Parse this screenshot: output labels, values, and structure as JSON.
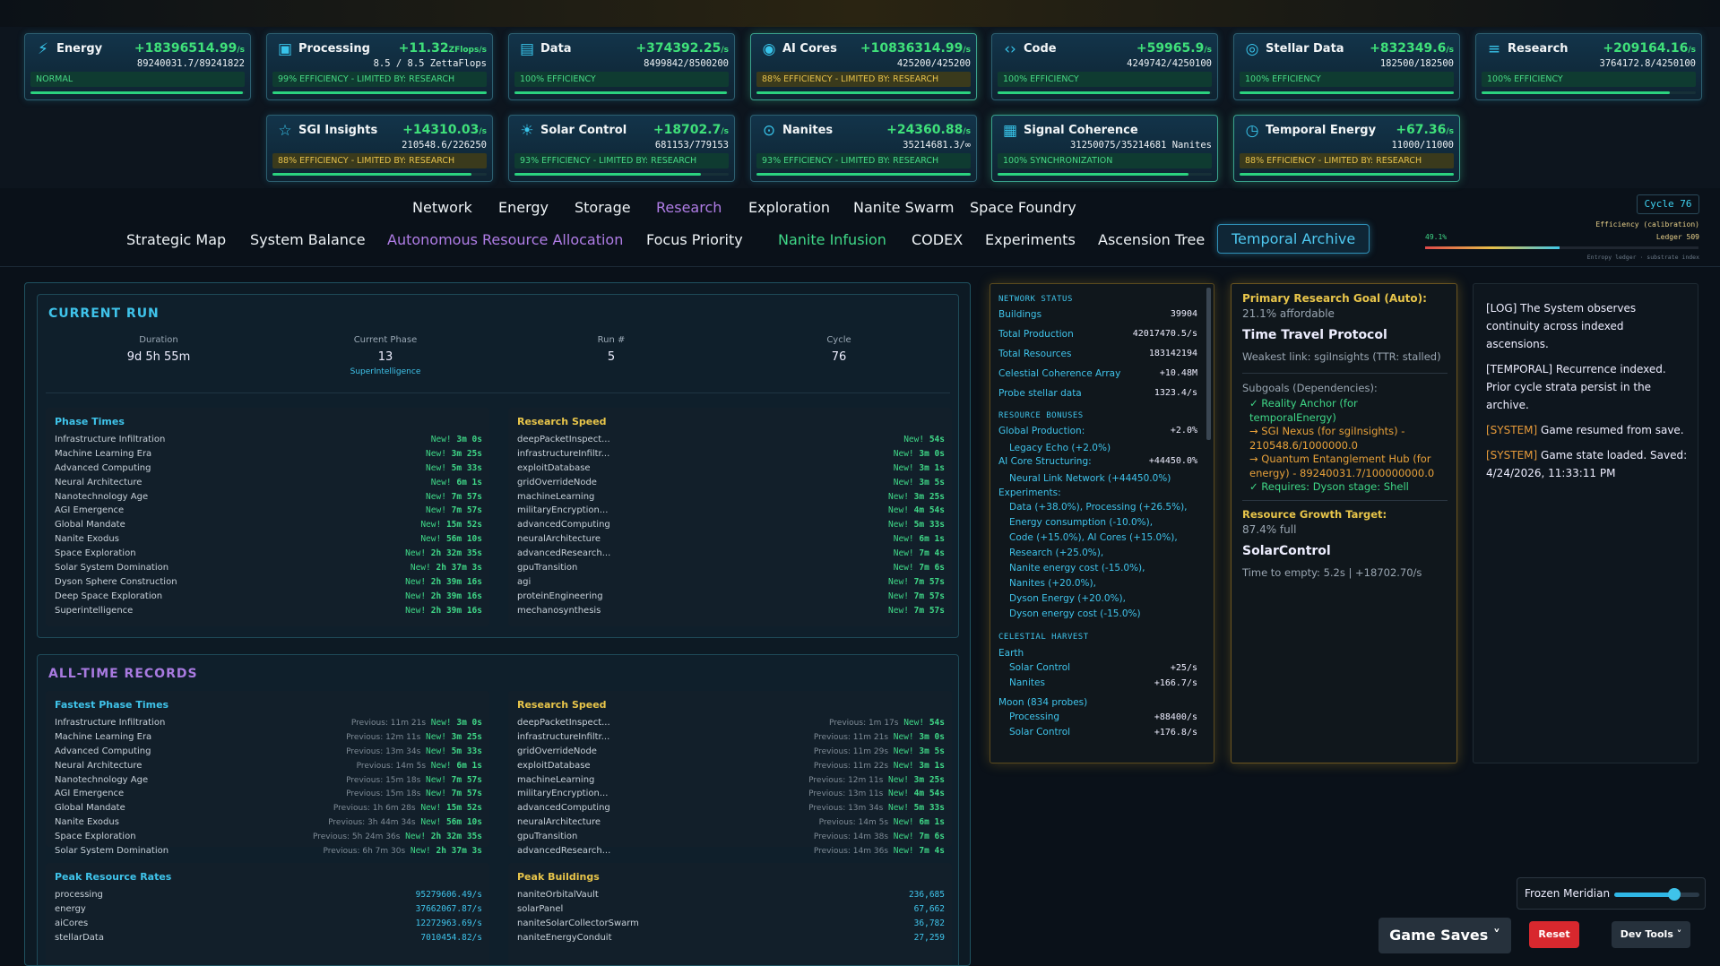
{
  "resources": [
    {
      "name": "Energy",
      "icon": "lightning-icon",
      "rate": "+18396514.99",
      "unit": "/s",
      "value": "89240031.7/89241822",
      "status": "NORMAL",
      "kind": "good",
      "fill": 0.99
    },
    {
      "name": "Processing",
      "icon": "cpu-icon",
      "rate": "+11.32",
      "unit": "ZFlops/s",
      "value": "8.5 / 8.5 ZettaFlops",
      "status": "99% EFFICIENCY - LIMITED BY: RESEARCH",
      "kind": "good",
      "fill": 1.0
    },
    {
      "name": "Data",
      "icon": "database-icon",
      "rate": "+374392.25",
      "unit": "/s",
      "value": "8499842/8500200",
      "status": "100% EFFICIENCY",
      "kind": "good",
      "fill": 0.99
    },
    {
      "name": "AI Cores",
      "icon": "ai-core-icon",
      "rate": "+10836314.99",
      "unit": "/s",
      "value": "425200/425200",
      "status": "88% EFFICIENCY - LIMITED BY: RESEARCH",
      "kind": "warn",
      "fill": 1.0
    },
    {
      "name": "Code",
      "icon": "code-icon",
      "rate": "+59965.9",
      "unit": "/s",
      "value": "4249742/4250100",
      "status": "100% EFFICIENCY",
      "kind": "good",
      "fill": 0.99
    },
    {
      "name": "Stellar Data",
      "icon": "stellar-data-icon",
      "rate": "+832349.6",
      "unit": "/s",
      "value": "182500/182500",
      "status": "100% EFFICIENCY",
      "kind": "good",
      "fill": 1.0
    },
    {
      "name": "Research",
      "icon": "research-layers-icon",
      "rate": "+209164.16",
      "unit": "/s",
      "value": "3764172.8/4250100",
      "status": "100% EFFICIENCY",
      "kind": "good",
      "fill": 0.88
    },
    {
      "name": "SGI Insights",
      "icon": "star-icon",
      "rate": "+14310.03",
      "unit": "/s",
      "value": "210548.6/226250",
      "status": "88% EFFICIENCY - LIMITED BY: RESEARCH",
      "kind": "warn",
      "fill": 0.93
    },
    {
      "name": "Solar Control",
      "icon": "sun-icon",
      "rate": "+18702.7",
      "unit": "/s",
      "value": "681153/779153",
      "status": "93% EFFICIENCY - LIMITED BY: RESEARCH",
      "kind": "good",
      "fill": 0.87
    },
    {
      "name": "Nanites",
      "icon": "nanite-icon",
      "rate": "+24360.88",
      "unit": "/s",
      "value": "35214681.3/∞",
      "status": "93% EFFICIENCY - LIMITED BY: RESEARCH",
      "kind": "good",
      "fill": 1.0
    },
    {
      "name": "Signal Coherence",
      "icon": "signal-icon",
      "rate": "",
      "unit": "",
      "value": "31250075/35214681 Nanites",
      "status": "100% SYNCHRONIZATION",
      "kind": "good",
      "fill": 0.89
    },
    {
      "name": "Temporal Energy",
      "icon": "clock-icon",
      "rate": "+67.36",
      "unit": "/s",
      "value": "11000/11000",
      "status": "88% EFFICIENCY - LIMITED BY: RESEARCH",
      "kind": "warn",
      "fill": 1.0
    }
  ],
  "nav_primary": [
    "Network",
    "Energy",
    "Storage",
    "Research",
    "Exploration",
    "Nanite Swarm",
    "Space Foundry"
  ],
  "nav_secondary": [
    "Strategic Map",
    "System Balance",
    "Autonomous Resource Allocation",
    "Focus Priority",
    "Nanite Infusion",
    "CODEX",
    "Experiments",
    "Ascension Tree",
    "Temporal Archive"
  ],
  "calib": {
    "cycle": "Cycle 76",
    "eff_label": "Efficiency (calibration)",
    "pct": "49.1%",
    "ledger": "Ledger 509",
    "foot": "Entropy ledger · substrate index"
  },
  "current_run": {
    "title": "CURRENT RUN",
    "duration_label": "Duration",
    "duration": "9d 5h 55m",
    "phase_label": "Current Phase",
    "phase": "13",
    "phase_name": "SuperIntelligence",
    "run_label": "Run #",
    "run": "5",
    "cycle_label": "Cycle",
    "cycle": "76"
  },
  "phase_times": {
    "title": "Phase Times",
    "rows": [
      [
        "Infrastructure Infiltration",
        "3m 0s"
      ],
      [
        "Machine Learning Era",
        "3m 25s"
      ],
      [
        "Advanced Computing",
        "5m 33s"
      ],
      [
        "Neural Architecture",
        "6m 1s"
      ],
      [
        "Nanotechnology Age",
        "7m 57s"
      ],
      [
        "AGI Emergence",
        "7m 57s"
      ],
      [
        "Global Mandate",
        "15m 52s"
      ],
      [
        "Nanite Exodus",
        "56m 10s"
      ],
      [
        "Space Exploration",
        "2h 32m 35s"
      ],
      [
        "Solar System Domination",
        "2h 37m 3s"
      ],
      [
        "Dyson Sphere Construction",
        "2h 39m 16s"
      ],
      [
        "Deep Space Exploration",
        "2h 39m 16s"
      ],
      [
        "Superintelligence",
        "2h 39m 16s"
      ]
    ]
  },
  "research_speed": {
    "title": "Research Speed",
    "rows": [
      [
        "deepPacketInspect...",
        "54s"
      ],
      [
        "infrastructureInfiltr...",
        "3m 0s"
      ],
      [
        "exploitDatabase",
        "3m 1s"
      ],
      [
        "gridOverrideNode",
        "3m 5s"
      ],
      [
        "machineLearning",
        "3m 25s"
      ],
      [
        "militaryEncryption...",
        "4m 54s"
      ],
      [
        "advancedComputing",
        "5m 33s"
      ],
      [
        "neuralArchitecture",
        "6m 1s"
      ],
      [
        "advancedResearch...",
        "7m 4s"
      ],
      [
        "gpuTransition",
        "7m 6s"
      ],
      [
        "agi",
        "7m 57s"
      ],
      [
        "proteinEngineering",
        "7m 57s"
      ],
      [
        "mechanosynthesis",
        "7m 57s"
      ]
    ]
  },
  "new_label": "New!",
  "records": {
    "title": "ALL-TIME RECORDS",
    "fastest_title": "Fastest Phase Times",
    "fastest": [
      [
        "Infrastructure Infiltration",
        "Previous: 11m 21s",
        "3m 0s"
      ],
      [
        "Machine Learning Era",
        "Previous: 12m 11s",
        "3m 25s"
      ],
      [
        "Advanced Computing",
        "Previous: 13m 34s",
        "5m 33s"
      ],
      [
        "Neural Architecture",
        "Previous: 14m 5s",
        "6m 1s"
      ],
      [
        "Nanotechnology Age",
        "Previous: 15m 18s",
        "7m 57s"
      ],
      [
        "AGI Emergence",
        "Previous: 15m 18s",
        "7m 57s"
      ],
      [
        "Global Mandate",
        "Previous: 1h 6m 28s",
        "15m 52s"
      ],
      [
        "Nanite Exodus",
        "Previous: 3h 44m 34s",
        "56m 10s"
      ],
      [
        "Space Exploration",
        "Previous: 5h 24m 36s",
        "2h 32m 35s"
      ],
      [
        "Solar System Domination",
        "Previous: 6h 7m 30s",
        "2h 37m 3s"
      ]
    ],
    "speed_title": "Research Speed",
    "speed": [
      [
        "deepPacketInspect...",
        "Previous: 1m 17s",
        "54s"
      ],
      [
        "infrastructureInfiltr...",
        "Previous: 11m 21s",
        "3m 0s"
      ],
      [
        "gridOverrideNode",
        "Previous: 11m 29s",
        "3m 5s"
      ],
      [
        "exploitDatabase",
        "Previous: 11m 22s",
        "3m 1s"
      ],
      [
        "machineLearning",
        "Previous: 12m 11s",
        "3m 25s"
      ],
      [
        "militaryEncryption...",
        "Previous: 13m 11s",
        "4m 54s"
      ],
      [
        "advancedComputing",
        "Previous: 13m 34s",
        "5m 33s"
      ],
      [
        "neuralArchitecture",
        "Previous: 14m 5s",
        "6m 1s"
      ],
      [
        "gpuTransition",
        "Previous: 14m 38s",
        "7m 6s"
      ],
      [
        "advancedResearch...",
        "Previous: 14m 36s",
        "7m 4s"
      ]
    ],
    "peak_rates_title": "Peak Resource Rates",
    "peak_rates": [
      [
        "processing",
        "95279606.49/s"
      ],
      [
        "energy",
        "37662067.87/s"
      ],
      [
        "aiCores",
        "12272963.69/s"
      ],
      [
        "stellarData",
        "7010454.82/s"
      ]
    ],
    "peak_buildings_title": "Peak Buildings",
    "peak_buildings": [
      [
        "naniteOrbitalVault",
        "236,685"
      ],
      [
        "solarPanel",
        "67,662"
      ],
      [
        "naniteSolarCollectorSwarm",
        "36,782"
      ],
      [
        "naniteEnergyConduit",
        "27,259"
      ]
    ]
  },
  "network": {
    "status_title": "NETWORK STATUS",
    "status": [
      [
        "Buildings",
        "39904"
      ],
      [
        "Total Production",
        "42017470.5/s"
      ],
      [
        "Total Resources",
        "183142194"
      ],
      [
        "Celestial Coherence Array",
        "+10.48M"
      ],
      [
        "Probe stellar data",
        "1323.4/s"
      ]
    ],
    "bonus_title": "RESOURCE BONUSES",
    "global_label": "Global Production:",
    "global_val": "+2.0%",
    "legacy": "Legacy Echo (+2.0%)",
    "aicore_label": "AI Core Structuring:",
    "aicore_val": "+44450.0%",
    "neural": "Neural Link Network (+44450.0%)",
    "exp_label": "Experiments:",
    "exp_items": [
      "Data (+38.0%), Processing (+26.5%),",
      "Energy consumption (-10.0%),",
      "Code (+15.0%), AI Cores (+15.0%),",
      "Research (+25.0%),",
      "Nanite energy cost (-15.0%),",
      "Nanites (+20.0%),",
      "Dyson Energy (+20.0%),",
      "Dyson energy cost (-15.0%)"
    ],
    "harvest_title": "CELESTIAL HARVEST",
    "earth": "Earth",
    "earth_rows": [
      [
        "Solar Control",
        "+25/s"
      ],
      [
        "Nanites",
        "+166.7/s"
      ]
    ],
    "moon": "Moon (834 probes)",
    "moon_rows": [
      [
        "Processing",
        "+88400/s"
      ],
      [
        "Solar Control",
        "+176.8/s"
      ]
    ]
  },
  "goal": {
    "title": "Primary Research Goal (Auto):",
    "afford": "21.1% affordable",
    "name": "Time Travel Protocol",
    "weak": "Weakest link: sgiInsights (TTR: stalled)",
    "sub_title": "Subgoals (Dependencies):",
    "sub1": "✓ Reality Anchor (for temporalEnergy)",
    "sub2": "→ SGI Nexus (for sgiInsights) - 210548.6/1000000.0",
    "sub3": "→ Quantum Entanglement Hub (for energy) - 89240031.7/100000000.0",
    "sub4": "✓ Requires: Dyson stage: Shell",
    "growth_title": "Resource Growth Target:",
    "growth_full": "87.4% full",
    "growth_name": "SolarControl",
    "growth_time": "Time to empty: 5.2s | +18702.70/s"
  },
  "log": {
    "l1": "[LOG] The System observes continuity across indexed ascensions.",
    "l2": "[TEMPORAL] Recurrence indexed. Prior cycle strata persist in the archive.",
    "l3tag": "[SYSTEM]",
    "l3": " Game resumed from save.",
    "l4tag": "[SYSTEM]",
    "l4": " Game state loaded. Saved: 4/24/2026, 11:33:11 PM"
  },
  "controls": {
    "frozen": "Frozen Meridian",
    "frozen_level": 0.7,
    "saves": "Game Saves ˅",
    "reset": "Reset",
    "dev": "Dev Tools ˅"
  }
}
